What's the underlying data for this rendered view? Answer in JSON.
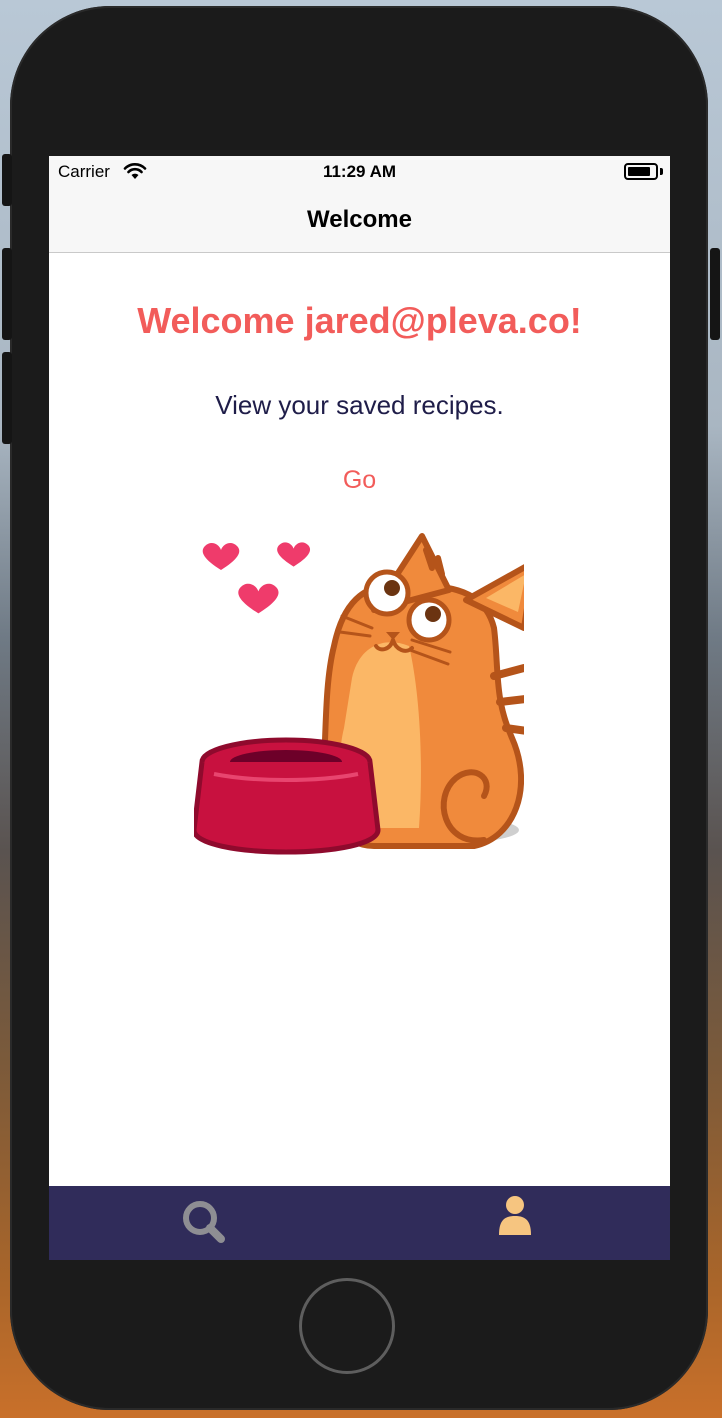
{
  "status_bar": {
    "carrier": "Carrier",
    "time": "11:29 AM",
    "icons": [
      "wifi-icon",
      "battery-icon"
    ]
  },
  "nav_bar": {
    "title": "Welcome"
  },
  "main": {
    "heading": "Welcome jared@pleva.co!",
    "subtitle": "View your saved recipes.",
    "go_button_label": "Go",
    "illustration": "cat-with-food-bowl-and-hearts"
  },
  "tab_bar": {
    "tabs": [
      {
        "icon": "search-icon",
        "selected": false
      },
      {
        "icon": "user-icon",
        "selected": true
      }
    ]
  },
  "colors": {
    "accent": "#f25c5a",
    "subtitle_text": "#1f1d49",
    "tab_bar_background": "#302c5a",
    "tab_inactive": "#8e8e93",
    "tab_active": "#f6c580"
  }
}
